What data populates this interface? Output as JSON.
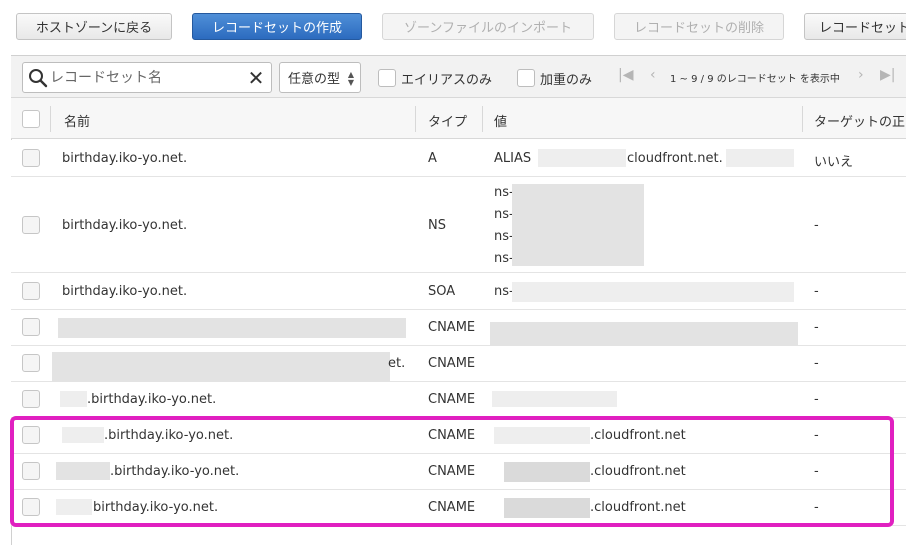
{
  "toolbar": {
    "back": "ホストゾーンに戻る",
    "create": "レコードセットの作成",
    "import": "ゾーンファイルのインポート",
    "delete": "レコードセットの削除",
    "more": "レコードセット"
  },
  "filter": {
    "search_placeholder": "レコードセット名",
    "type_select": "任意の型",
    "alias_only": "エイリアスのみ",
    "weighted_only": "加重のみ",
    "pager": "1 ~ 9 / 9 のレコードセット を表示中"
  },
  "columns": {
    "name": "名前",
    "type": "タイプ",
    "value": "値",
    "target_health": "ターゲットの正"
  },
  "rows": [
    {
      "name": "birthday.iko-yo.net.",
      "type": "A",
      "value_prefix": "ALIAS",
      "value_mid": "cloudfront.net. (",
      "health": "いいえ"
    },
    {
      "name": "birthday.iko-yo.net.",
      "type": "NS",
      "values": [
        "ns-",
        "ns-",
        "ns-",
        "ns-"
      ],
      "health": "-"
    },
    {
      "name": "birthday.iko-yo.net.",
      "type": "SOA",
      "value": "ns-",
      "health": "-"
    },
    {
      "name": "",
      "type": "CNAME",
      "value": "",
      "health": "-"
    },
    {
      "name": "et.",
      "type": "CNAME",
      "value": "",
      "health": "-"
    },
    {
      "name": ".birthday.iko-yo.net.",
      "type": "CNAME",
      "value": "",
      "health": "-"
    },
    {
      "name": ".birthday.iko-yo.net.",
      "type": "CNAME",
      "value": ".cloudfront.net",
      "health": "-"
    },
    {
      "name": ".birthday.iko-yo.net.",
      "type": "CNAME",
      "value": ".cloudfront.net",
      "health": "-"
    },
    {
      "name": "birthday.iko-yo.net.",
      "type": "CNAME",
      "value": ".cloudfront.net",
      "health": "-"
    }
  ],
  "colors": {
    "primary": "#2c6bbf",
    "highlight": "#e020c0"
  }
}
